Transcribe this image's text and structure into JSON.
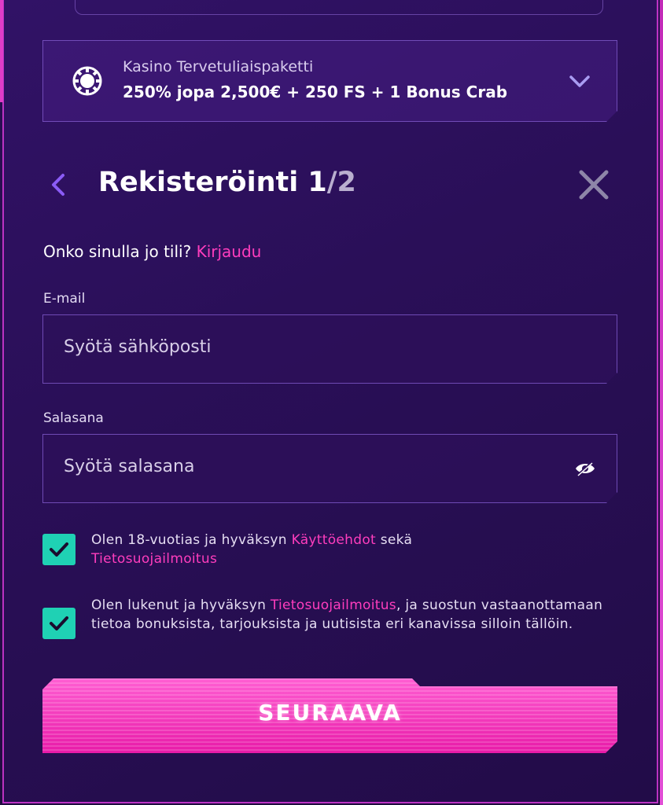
{
  "bonus": {
    "title": "Kasino Tervetuliaispaketti",
    "offer": "250% jopa 2,500€ + 250 FS + 1 Bonus Crab"
  },
  "header": {
    "title_main": "Rekisteröinti 1",
    "title_step": "/2"
  },
  "login_prompt": {
    "question": "Onko sinulla jo tili?",
    "link": "Kirjaudu"
  },
  "email": {
    "label": "E-mail",
    "placeholder": "Syötä sähköposti"
  },
  "password": {
    "label": "Salasana",
    "placeholder": "Syötä salasana"
  },
  "consent1": {
    "text_a": "Olen 18-vuotias ja hyväksyn ",
    "link_a": "Käyttöehdot",
    "text_b": " sekä ",
    "link_b": "Tietosuojailmoitus",
    "checked": true
  },
  "consent2": {
    "text_a": "Olen lukenut ja hyväksyn ",
    "link_a": "Tietosuojailmoitus",
    "text_b": ", ja suostun vastaanottamaan tietoa bonuksista, tarjouksista ja uutisista eri kanavissa silloin tällöin.",
    "checked": true
  },
  "next_button": {
    "label": "SEURAAVA"
  },
  "colors": {
    "accent_pink": "#ff3dbd",
    "check_teal": "#1fd1b4",
    "background": "#2a0f58"
  }
}
